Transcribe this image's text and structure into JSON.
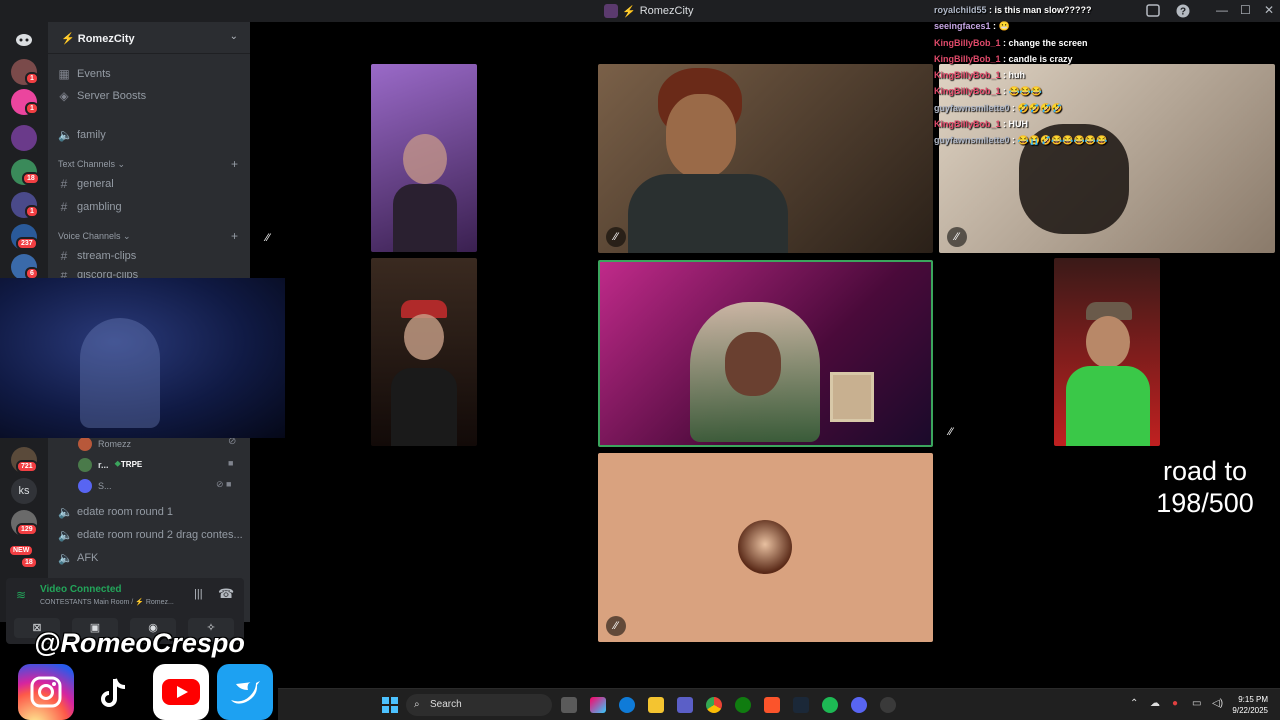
{
  "window": {
    "title": "RomezCity",
    "controls": [
      "—",
      "☐",
      "✕"
    ]
  },
  "server_rail": {
    "badges": [
      "1",
      "1",
      "18",
      "1",
      "237",
      "6",
      "721",
      "129",
      "18"
    ],
    "ks_label": "ks",
    "new_label": "NEW"
  },
  "sidebar": {
    "server_name": "RomezCity",
    "items": [
      {
        "label": "Events",
        "icon": "calendar-icon"
      },
      {
        "label": "Server Boosts",
        "icon": "boost-icon"
      },
      {
        "label": "family",
        "icon": "speaker-icon"
      }
    ],
    "text_category": "Text Channels",
    "text_channels": [
      "general",
      "gambling"
    ],
    "voice_category": "Voice Channels",
    "voice_channels_top": [
      "stream-clips",
      "discord-clips"
    ],
    "voice_users": [
      {
        "name": "Romezz",
        "badge": ""
      },
      {
        "name": "r...",
        "badge": "TRPE"
      },
      {
        "name": "S...",
        "badge": ""
      }
    ],
    "voice_channels_bottom": [
      "edate room round 1",
      "edate room round 2 drag contes...",
      "AFK"
    ]
  },
  "voice_panel": {
    "status": "Video Connected",
    "subtitle": "CONTESTANTS Main Room / ⚡ Romez..."
  },
  "chat": [
    {
      "user": "royalchild55",
      "msg": " : is this man slow?????",
      "style": "g3"
    },
    {
      "user": "seeingfaces1",
      "msg": " : 😬",
      "style": "g1"
    },
    {
      "user": "KingBillyBob_1",
      "msg": " : change the screen",
      "style": "g2"
    },
    {
      "user": "KingBillyBob_1",
      "msg": " : candle is crazy",
      "style": "g2"
    },
    {
      "user": "KingBillyBob_1",
      "msg": " : huh",
      "style": "g2"
    },
    {
      "user": "KingBillyBob_1",
      "msg": " : 😂😂😂",
      "style": "g2"
    },
    {
      "user": "guyfawnsmilette0",
      "msg": " : 🤣🤣🤣🤣",
      "style": "g3"
    },
    {
      "user": "KingBillyBob_1",
      "msg": " : HUH",
      "style": "g2"
    },
    {
      "user": "guyfawnsmilette0",
      "msg": " : 😂😭🤣😂😂😂😂😂",
      "style": "g3"
    }
  ],
  "overlay": {
    "road_line1": "road to",
    "road_line2": "198/500",
    "handle": "@RomeoCrespo"
  },
  "taskbar": {
    "search_placeholder": "Search",
    "time": "9:15 PM",
    "date": "9/22/2025"
  },
  "colors": {
    "discord_bg": "#2b2d31",
    "rail_bg": "#1e1f22",
    "connected_green": "#23a55a",
    "speaking_border": "#3ba55d",
    "empty_tile": "#d9a27f"
  }
}
